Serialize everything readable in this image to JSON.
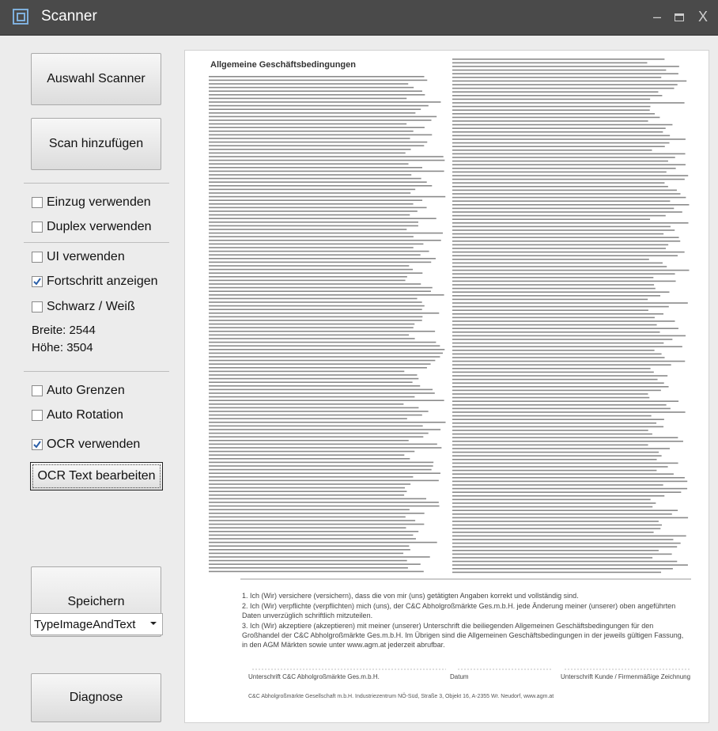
{
  "window": {
    "title": "Scanner"
  },
  "sidebar": {
    "auswahl_scanner": "Auswahl Scanner",
    "scan_hinzufuegen": "Scan hinzufügen",
    "checkboxes_top": [
      {
        "label": "Einzug verwenden",
        "checked": false
      },
      {
        "label": "Duplex verwenden",
        "checked": false
      }
    ],
    "checkboxes_mid": [
      {
        "label": "UI verwenden",
        "checked": false
      },
      {
        "label": "Fortschritt anzeigen",
        "checked": true
      },
      {
        "label": "Schwarz / Weiß",
        "checked": false
      }
    ],
    "breite": "Breite: 2544",
    "hoehe": "Höhe: 3504",
    "checkboxes_bottom": [
      {
        "label": "Auto Grenzen",
        "checked": false
      },
      {
        "label": "Auto Rotation",
        "checked": false
      },
      {
        "label": "OCR verwenden",
        "checked": true
      }
    ],
    "ocr_text_bearbeiten": "OCR Text bearbeiten",
    "speichern": "Speichern",
    "type_select": "TypeImageAndText",
    "diagnose": "Diagnose"
  },
  "preview": {
    "heading": "Allgemeine Geschäftsbedingungen",
    "list": [
      "1. Ich (Wir) versichere (versichern), dass die von mir (uns) getätigten Angaben korrekt und vollständig sind.",
      "2. Ich (Wir) verpflichte (verpflichten) mich (uns), der C&C Abholgroßmärkte Ges.m.b.H. jede Änderung meiner (unserer) oben angeführten Daten unverzüglich schriftlich mitzuteilen.",
      "3. Ich (Wir) akzeptiere (akzeptieren) mit meiner (unserer) Unterschrift die beiliegenden Allgemeinen Geschäftsbedingungen für den Großhandel der C&C Abholgroßmärkte Ges.m.b.H. Im Übrigen sind die Allgemeinen Geschäftsbedingungen in der jeweils gültigen Fassung, in den AGM Märkten sowie unter www.agm.at jederzeit abrufbar."
    ],
    "sig_left": "Unterschrift C&C Abholgroßmärkte Ges.m.b.H.",
    "sig_mid": "Datum",
    "sig_right": "Unterschrift Kunde / Firmenmäßige Zeichnung",
    "footer": "C&C Abholgroßmärkte Gesellschaft m.b.H. Industriezentrum NÖ-Süd, Straße 3, Objekt 16, A-2355 Wr. Neudorf, www.agm.at"
  }
}
